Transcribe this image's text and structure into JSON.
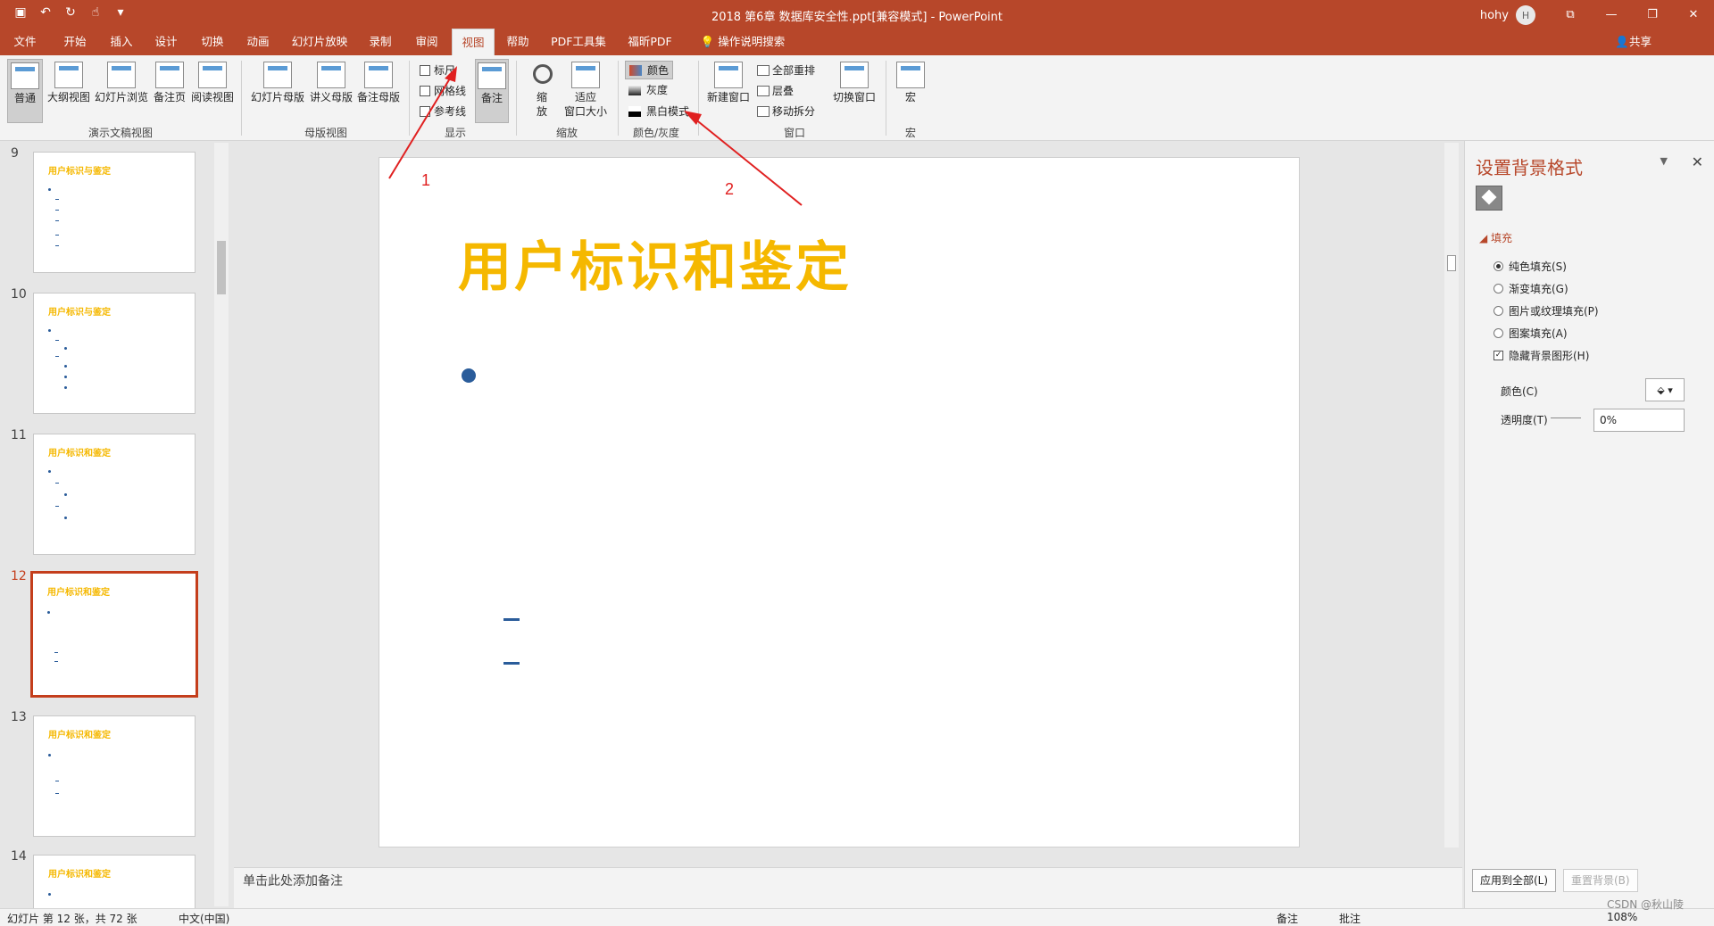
{
  "window": {
    "title": "2018 第6章 数据库安全性.ppt[兼容模式]  -  PowerPoint",
    "user": "hohy",
    "user_initial": "H",
    "minimize": "—",
    "restore": "❐",
    "close": "✕",
    "ribbon_display": "⧉"
  },
  "qat": {
    "save": "▣",
    "undo": "↶",
    "redo": "↻",
    "touch": "☝",
    "more": "▾"
  },
  "tabs": [
    "文件",
    "开始",
    "插入",
    "设计",
    "切换",
    "动画",
    "幻灯片放映",
    "录制",
    "审阅",
    "视图",
    "帮助",
    "PDF工具集",
    "福昕PDF",
    "操作说明搜索"
  ],
  "share": "共享",
  "ribbon": {
    "presentation_views": {
      "group": "演示文稿视图",
      "buttons": [
        "普通",
        "大纲视图",
        "幻灯片浏览",
        "备注页",
        "阅读视图"
      ]
    },
    "master_views": {
      "group": "母版视图",
      "buttons": [
        "幻灯片母版",
        "讲义母版",
        "备注母版"
      ]
    },
    "show": {
      "group": "显示",
      "checks": [
        "标尺",
        "网格线",
        "参考线"
      ],
      "notes": "备注"
    },
    "zoom": {
      "group": "缩放",
      "zoom": "缩\n放",
      "fit": "适应\n窗口大小"
    },
    "color": {
      "group": "颜色/灰度",
      "items": [
        "颜色",
        "灰度",
        "黑白模式"
      ]
    },
    "window": {
      "group": "窗口",
      "new_window": "新建窗口",
      "items": [
        "全部重排",
        "层叠",
        "移动拆分"
      ],
      "switch": "切换窗口"
    },
    "macros": {
      "group": "宏",
      "label": "宏"
    }
  },
  "thumbnails": [
    {
      "num": "9",
      "title": "用户标识与鉴定"
    },
    {
      "num": "10",
      "title": "用户标识与鉴定"
    },
    {
      "num": "11",
      "title": "用户标识和鉴定"
    },
    {
      "num": "12",
      "title": "用户标识和鉴定"
    },
    {
      "num": "13",
      "title": "用户标识和鉴定"
    },
    {
      "num": "14",
      "title": "用户标识和鉴定"
    }
  ],
  "slide": {
    "title": "用户标识和鉴定"
  },
  "notes_placeholder": "单击此处添加备注",
  "pane": {
    "title": "设置背景格式",
    "section": "填充",
    "fills": [
      "纯色填充(S)",
      "渐变填充(G)",
      "图片或纹理填充(P)",
      "图案填充(A)"
    ],
    "hide_bg": "隐藏背景图形(H)",
    "color_label": "颜色(C)",
    "color_btn": "⬙ ▾",
    "transparency_label": "透明度(T)",
    "transparency_value": "0%",
    "apply_all": "应用到全部(L)",
    "reset": "重置背景(B)"
  },
  "annotations": {
    "a1": "1",
    "a2": "2"
  },
  "status": {
    "slide": "幻灯片 第 12 张，共 72 张",
    "lang": "中文(中国)",
    "notes": "备注",
    "comments": "批注",
    "zoom": "108%",
    "watermark": "CSDN @秋山陵"
  }
}
